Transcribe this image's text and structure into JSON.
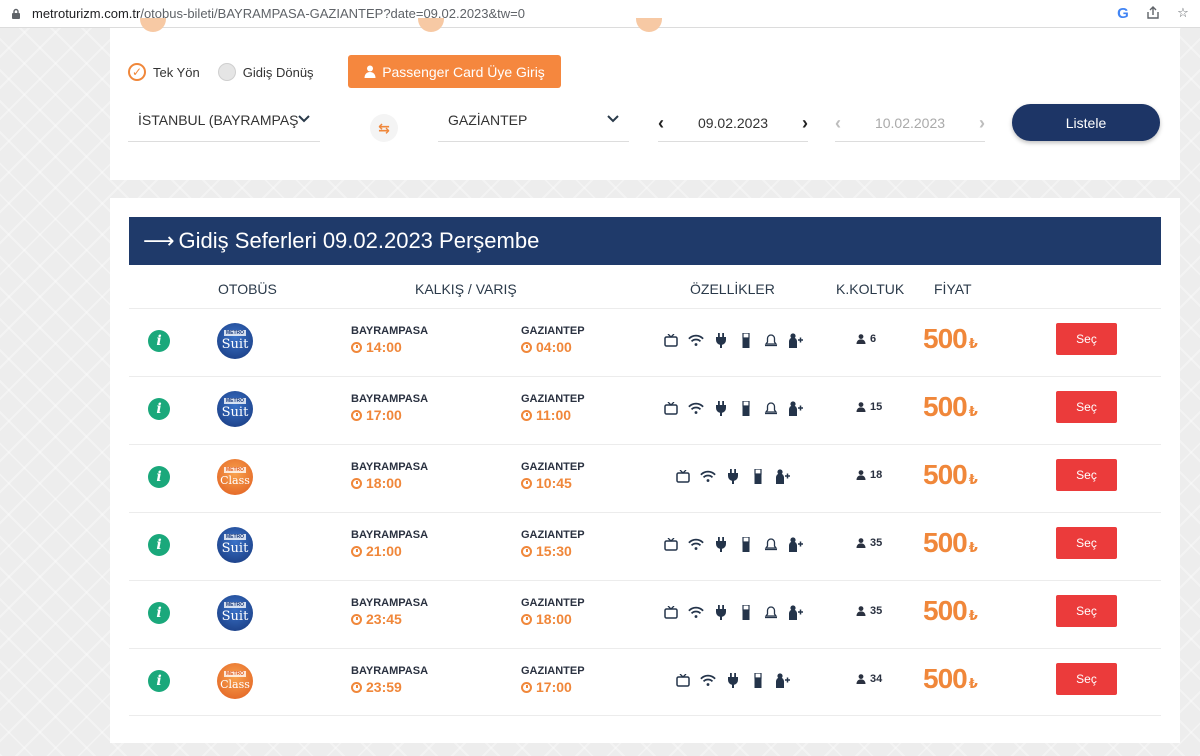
{
  "browser": {
    "url_host": "metroturizm.com.tr",
    "url_path": "/otobus-bileti/BAYRAMPASA-GAZIANTEP?date=09.02.2023&tw=0"
  },
  "search": {
    "one_way_label": "Tek Yön",
    "round_trip_label": "Gidiş Dönüş",
    "passenger_card_label": "Passenger Card Üye Giriş",
    "from_value": "İSTANBUL (BAYRAMPAŞA",
    "to_value": "GAZİANTEP",
    "depart_date": "09.02.2023",
    "return_date": "10.02.2023",
    "list_button": "Listele"
  },
  "results": {
    "title": "Gidiş Seferleri 09.02.2023 Perşembe",
    "columns": {
      "bus": "OTOBÜS",
      "times": "KALKIŞ / VARIŞ",
      "features": "ÖZELLİKLER",
      "seats": "K.KOLTUK",
      "price": "FİYAT"
    },
    "currency": "₺",
    "select_label": "Seç",
    "logo_brand": "METRO",
    "trips": [
      {
        "bus": "Suit",
        "from": "BAYRAMPASA",
        "depart": "14:00",
        "to": "GAZIANTEP",
        "arrive": "04:00",
        "seats": "6",
        "price": "500",
        "features": [
          "tv",
          "wifi",
          "plug",
          "usb",
          "bell",
          "steward"
        ]
      },
      {
        "bus": "Suit",
        "from": "BAYRAMPASA",
        "depart": "17:00",
        "to": "GAZIANTEP",
        "arrive": "11:00",
        "seats": "15",
        "price": "500",
        "features": [
          "tv",
          "wifi",
          "plug",
          "usb",
          "bell",
          "steward"
        ]
      },
      {
        "bus": "Class",
        "from": "BAYRAMPASA",
        "depart": "18:00",
        "to": "GAZIANTEP",
        "arrive": "10:45",
        "seats": "18",
        "price": "500",
        "features": [
          "tv",
          "wifi",
          "plug",
          "usb",
          "steward"
        ]
      },
      {
        "bus": "Suit",
        "from": "BAYRAMPASA",
        "depart": "21:00",
        "to": "GAZIANTEP",
        "arrive": "15:30",
        "seats": "35",
        "price": "500",
        "features": [
          "tv",
          "wifi",
          "plug",
          "usb",
          "bell",
          "steward"
        ]
      },
      {
        "bus": "Suit",
        "from": "BAYRAMPASA",
        "depart": "23:45",
        "to": "GAZIANTEP",
        "arrive": "18:00",
        "seats": "35",
        "price": "500",
        "features": [
          "tv",
          "wifi",
          "plug",
          "usb",
          "bell",
          "steward"
        ]
      },
      {
        "bus": "Class",
        "from": "BAYRAMPASA",
        "depart": "23:59",
        "to": "GAZIANTEP",
        "arrive": "17:00",
        "seats": "34",
        "price": "500",
        "features": [
          "tv",
          "wifi",
          "plug",
          "usb",
          "steward"
        ]
      }
    ]
  },
  "colors": {
    "accent_orange": "#f0873a",
    "header_navy": "#1f3a6a",
    "select_red": "#eb3b3b",
    "info_green": "#1aa87b"
  }
}
